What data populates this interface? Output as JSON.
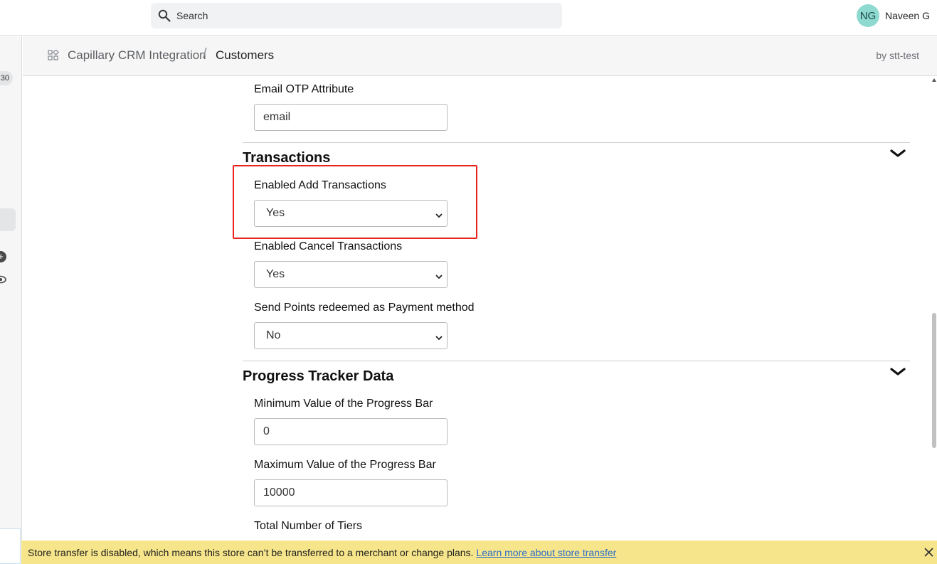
{
  "topbar": {
    "search_placeholder": "Search",
    "user": {
      "initials": "NG",
      "name": "Naveen G",
      "avatar_color": "#8ed9d0"
    }
  },
  "sidebar": {
    "badge": "30"
  },
  "header": {
    "app_name": "Capillary CRM Integration",
    "separator": "/",
    "page": "Customers",
    "by_line": "by stt-test"
  },
  "form": {
    "email_otp": {
      "label": "Email OTP Attribute",
      "value": "email"
    },
    "transactions": {
      "title": "Transactions",
      "enabled_add": {
        "label": "Enabled Add Transactions",
        "value": "Yes"
      },
      "enabled_cancel": {
        "label": "Enabled Cancel Transactions",
        "value": "Yes"
      },
      "send_points": {
        "label": "Send Points redeemed as Payment method",
        "value": "No"
      }
    },
    "progress": {
      "title": "Progress Tracker Data",
      "min": {
        "label": "Minimum Value of the Progress Bar",
        "value": "0"
      },
      "max": {
        "label": "Maximum Value of the Progress Bar",
        "value": "10000"
      },
      "tiers": {
        "label": "Total Number of Tiers"
      }
    }
  },
  "highlight_color": "#e8231b",
  "banner": {
    "text": "Store transfer is disabled, which means this store can’t be transferred to a merchant or change plans.",
    "link": "Learn more about store transfer",
    "background": "#f6e58b"
  }
}
